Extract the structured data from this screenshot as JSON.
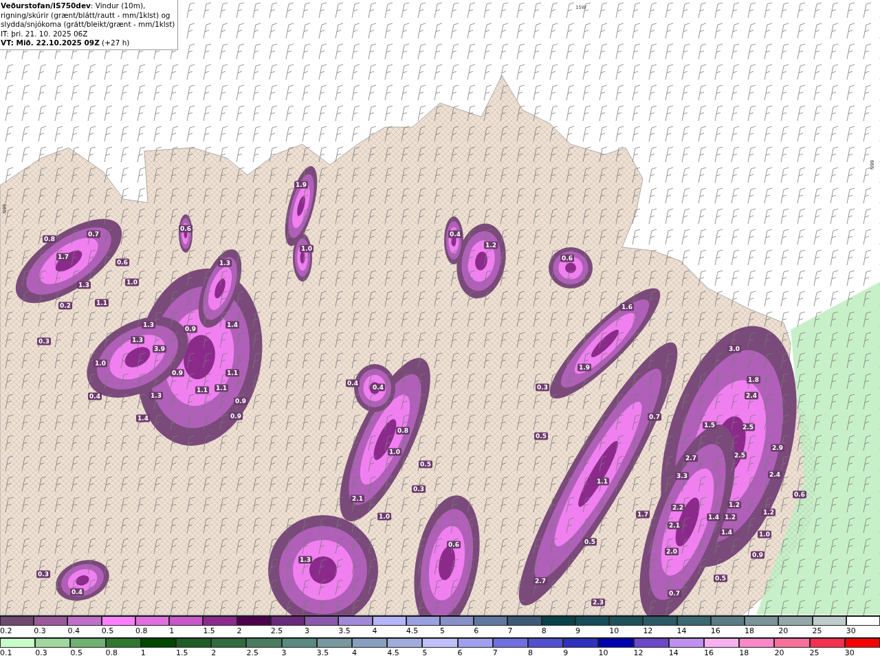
{
  "header": {
    "lines": [
      "**Veðurstofan/IS750dev**: Vindur (10m),",
      "rigning/skúrir (grænt/blátt/rautt - mm/1klst) og",
      "slydda/snjókoma (grátt/bleikt/grænt - mm/1klst)",
      "IT: þri. 21. 10. 2025 06Z",
      "**VT: Mið. 22.10.2025 09Z** (+27 h)"
    ]
  },
  "map": {
    "grid_labels": [
      "15W",
      "N99",
      "N99"
    ],
    "values": [
      "1.9",
      "0.6",
      "0.8",
      "0.7",
      "1.7",
      "1.3",
      "0.6",
      "1.0",
      "1.3",
      "1.0",
      "1.1",
      "0.2",
      "0.3",
      "1.3",
      "1.3",
      "3.9",
      "1.4",
      "0.9",
      "1.0",
      "0.9",
      "1.1",
      "0.4",
      "1.3",
      "1.1",
      "1.1",
      "0.9",
      "0.9",
      "1.4",
      "0.4",
      "1.2",
      "0.6",
      "1.6",
      "1.9",
      "0.3",
      "0.5",
      "0.4",
      "0.4",
      "0.8",
      "1.0",
      "0.5",
      "0.3",
      "2.1",
      "1.0",
      "0.6",
      "1.3",
      "0.3",
      "0.4",
      "3.0",
      "1.8",
      "2.4",
      "1.5",
      "2.5",
      "2.7",
      "2.5",
      "2.9",
      "3.3",
      "2.4",
      "1.1",
      "1.7",
      "2.2",
      "1.4",
      "1.2",
      "1.2",
      "1.2",
      "2.1",
      "1.4",
      "1.0",
      "2.0",
      "0.9",
      "0.5",
      "2.7",
      "0.5",
      "2.3",
      "0.7",
      "0.7",
      "0.6"
    ]
  },
  "legend_rain": [
    {
      "label": "0.2",
      "color": "#6e4a6e"
    },
    {
      "label": "0.3",
      "color": "#9b5a9b"
    },
    {
      "label": "0.4",
      "color": "#c070c8"
    },
    {
      "label": "0.5",
      "color": "#ff80ff"
    },
    {
      "label": "0.8",
      "color": "#e070e0"
    },
    {
      "label": "1",
      "color": "#c858c8"
    },
    {
      "label": "1.5",
      "color": "#8c2a8c"
    },
    {
      "label": "2",
      "color": "#4c004c"
    },
    {
      "label": "2.5",
      "color": "#6a2a7a"
    },
    {
      "label": "3",
      "color": "#8c5aaa"
    },
    {
      "label": "3.5",
      "color": "#a08ad8"
    },
    {
      "label": "4",
      "color": "#b4b4ff"
    },
    {
      "label": "4.5",
      "color": "#98a0e0"
    },
    {
      "label": "5",
      "color": "#8890c8"
    },
    {
      "label": "6",
      "color": "#6078a0"
    },
    {
      "label": "7",
      "color": "#3a5a78"
    },
    {
      "label": "8",
      "color": "#0a4048"
    },
    {
      "label": "9",
      "color": "#184c58"
    },
    {
      "label": "10",
      "color": "#1e5058"
    },
    {
      "label": "12",
      "color": "#2a5a64"
    },
    {
      "label": "14",
      "color": "#3c6870"
    },
    {
      "label": "16",
      "color": "#5a7c84"
    },
    {
      "label": "18",
      "color": "#7a9498"
    },
    {
      "label": "20",
      "color": "#94a8aa"
    },
    {
      "label": "25",
      "color": "#c0cccc"
    },
    {
      "label": "30",
      "color": "#ffffff"
    }
  ],
  "legend_snow": [
    {
      "label": "0.1",
      "color": "#c8ffc8"
    },
    {
      "label": "0.3",
      "color": "#a0d8a0"
    },
    {
      "label": "0.5",
      "color": "#70b070"
    },
    {
      "label": "0.8",
      "color": "#307830"
    },
    {
      "label": "1",
      "color": "#004800"
    },
    {
      "label": "1.5",
      "color": "#205c28"
    },
    {
      "label": "2",
      "color": "#306c40"
    },
    {
      "label": "2.5",
      "color": "#4a7c60"
    },
    {
      "label": "3",
      "color": "#5a8a80"
    },
    {
      "label": "3.5",
      "color": "#7898a0"
    },
    {
      "label": "4",
      "color": "#88a0c0"
    },
    {
      "label": "4.5",
      "color": "#a0acdc"
    },
    {
      "label": "5",
      "color": "#c0c0ff"
    },
    {
      "label": "6",
      "color": "#a0a0f0"
    },
    {
      "label": "7",
      "color": "#7070e0"
    },
    {
      "label": "8",
      "color": "#5050d0"
    },
    {
      "label": "9",
      "color": "#3030c0"
    },
    {
      "label": "10",
      "color": "#0000b0"
    },
    {
      "label": "12",
      "color": "#6a48c8"
    },
    {
      "label": "14",
      "color": "#c090f0"
    },
    {
      "label": "16",
      "color": "#f8b0f0"
    },
    {
      "label": "18",
      "color": "#f888c8"
    },
    {
      "label": "20",
      "color": "#f8709c"
    },
    {
      "label": "25",
      "color": "#f83050"
    },
    {
      "label": "30",
      "color": "#f80000"
    }
  ]
}
